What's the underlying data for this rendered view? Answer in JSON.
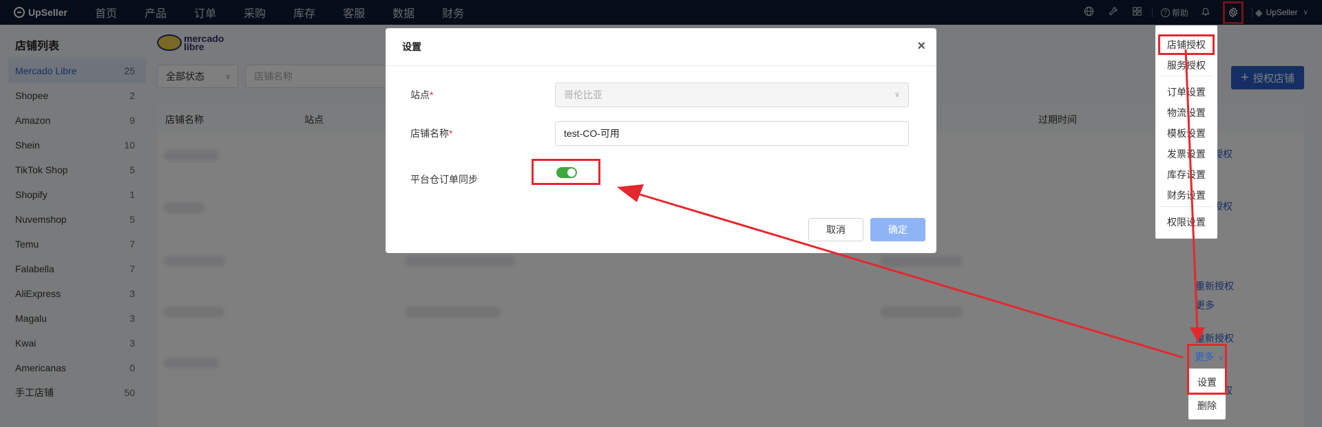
{
  "app": {
    "name": "UpSeller"
  },
  "nav": {
    "menu": [
      "首页",
      "产品",
      "订单",
      "采购",
      "库存",
      "客服",
      "数据",
      "财务"
    ],
    "help_label": "帮助",
    "user_label": "UpSeller",
    "icons": [
      "globe-icon",
      "wrench-icon",
      "apps-icon",
      "help-icon",
      "bell-icon",
      "gear-icon"
    ]
  },
  "sidebar": {
    "title": "店铺列表",
    "items": [
      {
        "label": "Mercado Libre",
        "count": "25"
      },
      {
        "label": "Shopee",
        "count": "2"
      },
      {
        "label": "Amazon",
        "count": "9"
      },
      {
        "label": "Shein",
        "count": "10"
      },
      {
        "label": "TikTok Shop",
        "count": "5"
      },
      {
        "label": "Shopify",
        "count": "1"
      },
      {
        "label": "Nuvemshop",
        "count": "5"
      },
      {
        "label": "Temu",
        "count": "7"
      },
      {
        "label": "Falabella",
        "count": "7"
      },
      {
        "label": "AliExpress",
        "count": "3"
      },
      {
        "label": "Magalu",
        "count": "3"
      },
      {
        "label": "Kwai",
        "count": "3"
      },
      {
        "label": "Americanas",
        "count": "0"
      },
      {
        "label": "手工店铺",
        "count": "50"
      }
    ]
  },
  "main": {
    "brand_logo_text": "mercado libre",
    "status_filter": "全部状态",
    "store_search_placeholder": "店铺名称",
    "auth_button": "授权店铺",
    "table": {
      "headers": [
        "店铺名称",
        "站点",
        "过期时间"
      ],
      "row_actions": [
        "授权",
        "授权",
        "重新授权",
        "重新授权",
        "授权"
      ],
      "more_label": "更多"
    }
  },
  "modal": {
    "title": "设置",
    "fields": {
      "site_label": "站点",
      "site_value": "哥伦比亚",
      "store_name_label": "店铺名称",
      "store_name_value": "test-CO-可用",
      "sync_label": "平台仓订单同步",
      "sync_enabled": true
    },
    "cancel": "取消",
    "confirm": "确定"
  },
  "gear_menu": {
    "items": [
      "店铺授权",
      "服务授权",
      "订单设置",
      "物流设置",
      "模板设置",
      "发票设置",
      "库存设置",
      "财务设置",
      "权限设置"
    ]
  },
  "more_menu": {
    "items": [
      "设置",
      "删除"
    ]
  },
  "colors": {
    "nav_bg": "#0b1a33",
    "accent": "#2b5fc8",
    "annotation_red": "#e4282e",
    "toggle_green": "#3fa93f"
  }
}
